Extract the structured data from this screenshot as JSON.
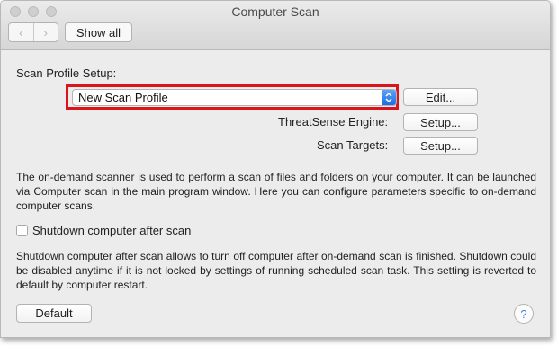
{
  "window": {
    "title": "Computer Scan"
  },
  "toolbar": {
    "back_glyph": "‹",
    "forward_glyph": "›",
    "show_all_label": "Show all"
  },
  "profile": {
    "section_label": "Scan Profile Setup:",
    "selected": "New Scan Profile",
    "edit_label": "Edit..."
  },
  "engine": {
    "label": "ThreatSense Engine:",
    "setup_label": "Setup..."
  },
  "targets": {
    "label": "Scan Targets:",
    "setup_label": "Setup..."
  },
  "description": "The on-demand scanner is used to perform a scan of files and folders on your computer. It can be launched via Computer scan in the main program window. Here you can configure parameters specific to on-demand computer scans.",
  "shutdown": {
    "checkbox_label": "Shutdown computer after scan",
    "checked": false,
    "description": "Shutdown computer after scan allows to turn off computer after on-demand scan is finished. Shutdown could be disabled anytime if it is not locked by settings of running scheduled scan task. This setting is reverted to default by computer restart."
  },
  "footer": {
    "default_label": "Default",
    "help_glyph": "?"
  },
  "colors": {
    "highlight": "#d9141b",
    "accent": "#1a6de3"
  }
}
